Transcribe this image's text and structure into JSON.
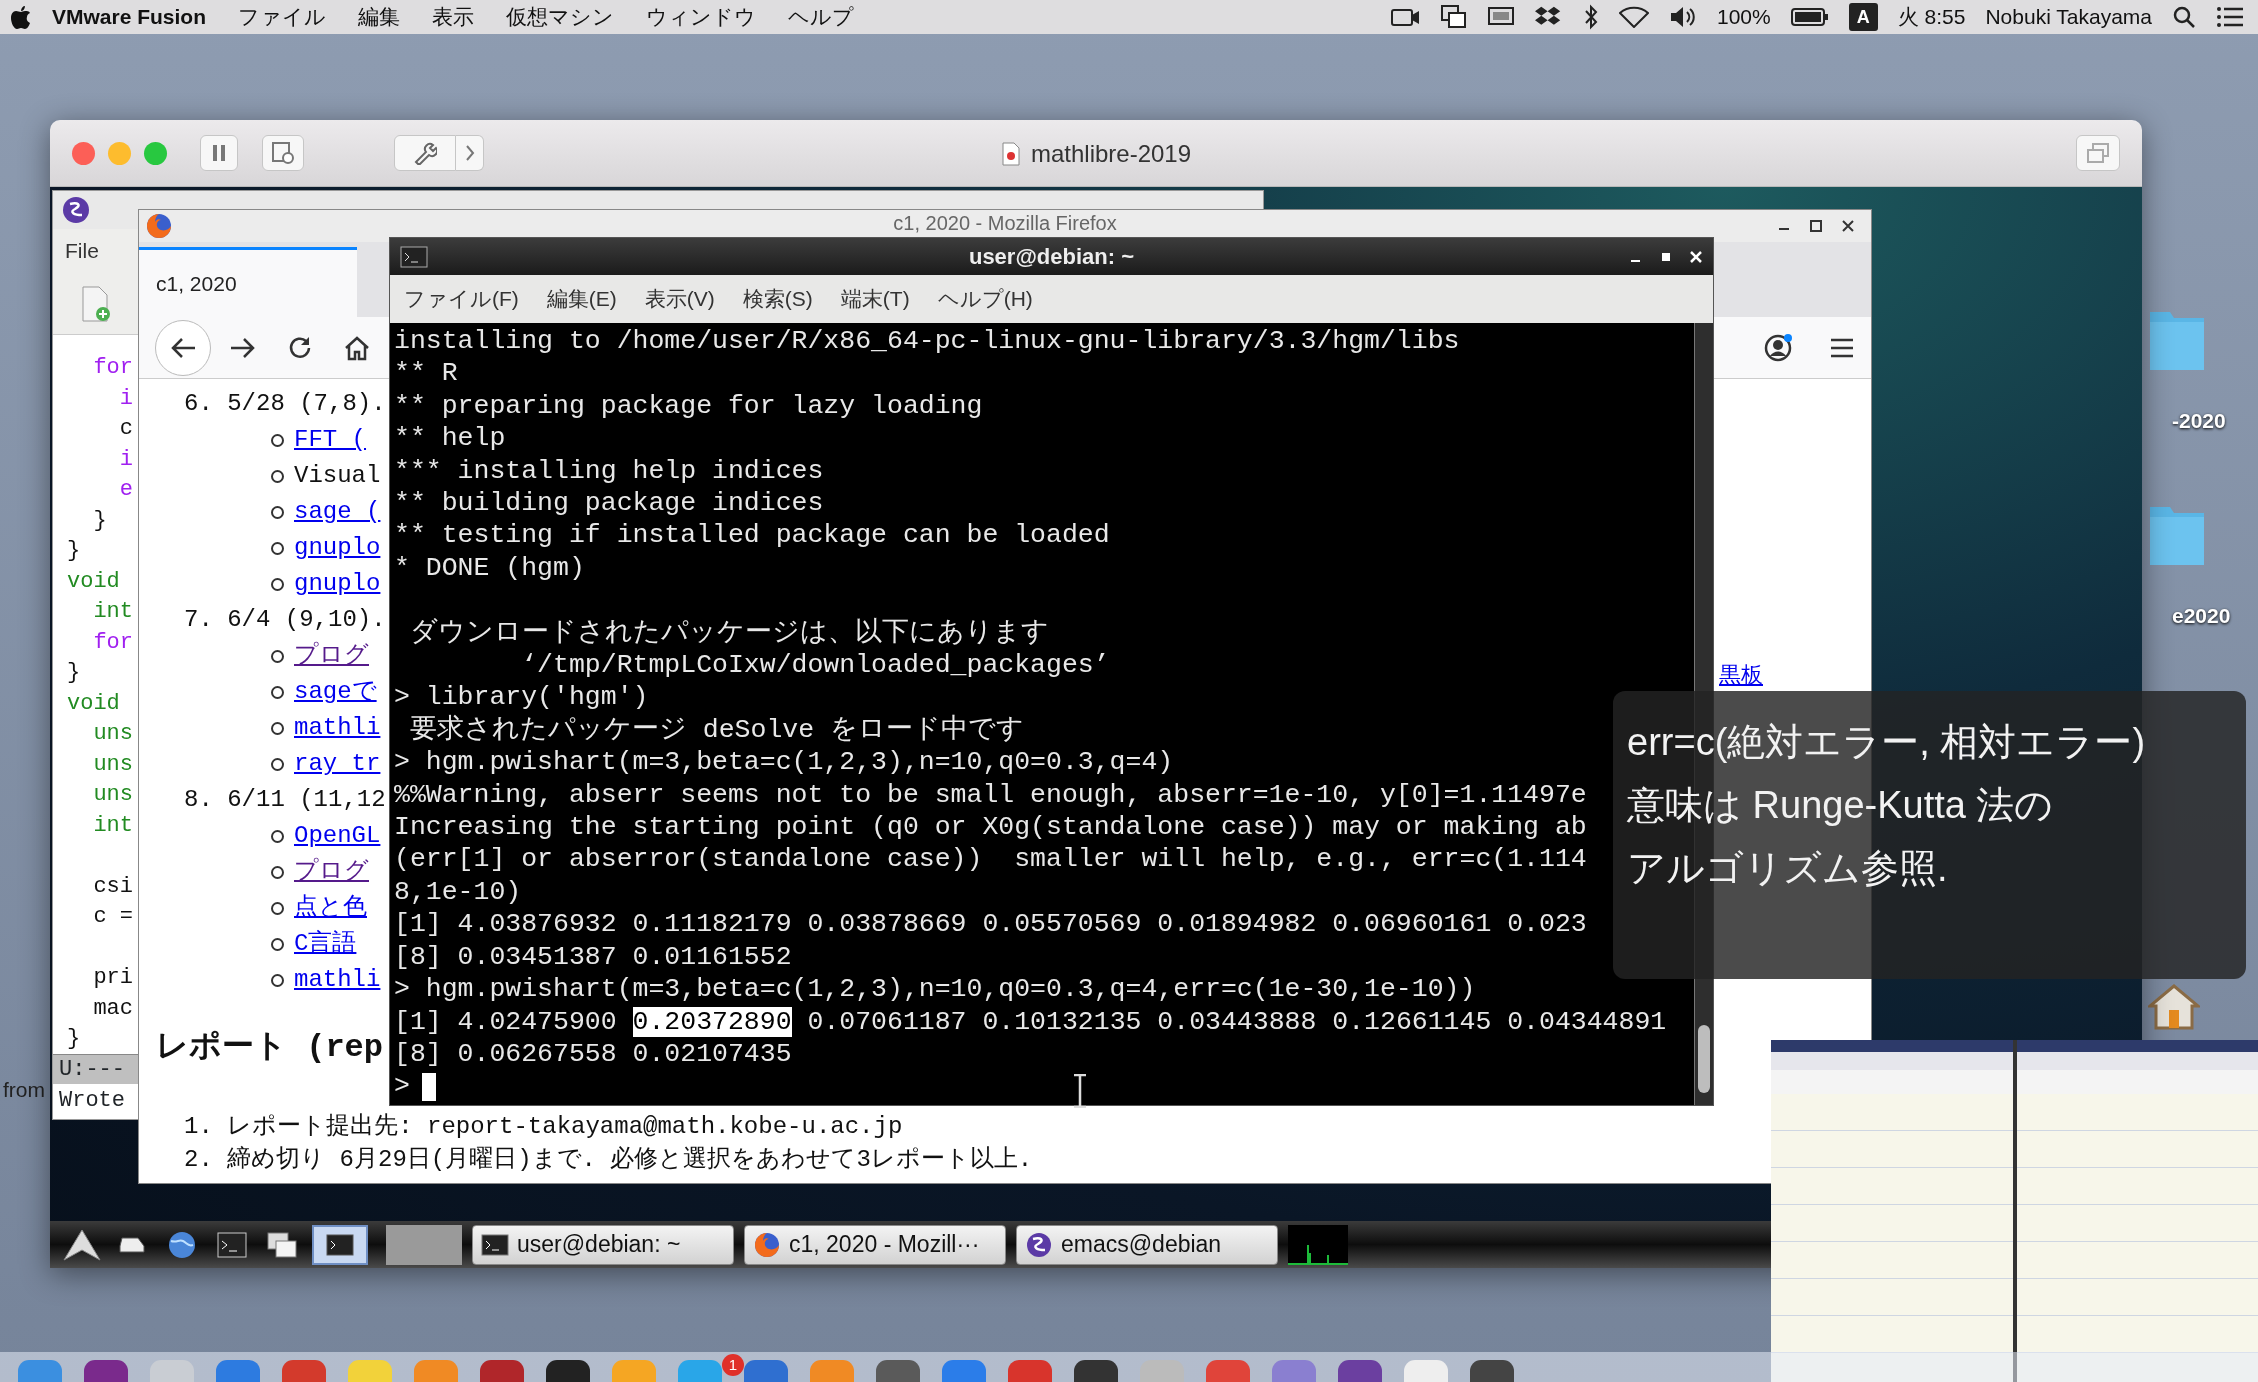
{
  "menu_bar": {
    "app": "VMware Fusion",
    "menus": [
      "ファイル",
      "編集",
      "表示",
      "仮想マシン",
      "ウィンドウ",
      "ヘルプ"
    ],
    "battery": "100%",
    "input_source": "A",
    "clock": "火 8:55",
    "user": "Nobuki Takayama"
  },
  "vm_window": {
    "title": "mathlibre-2019"
  },
  "emacs": {
    "menus": [
      "File"
    ],
    "lines": [
      {
        "text": "  for",
        "kind": "keyword"
      },
      {
        "text": "    i",
        "kind": "keyword"
      },
      {
        "text": "    c",
        "kind": "plain"
      },
      {
        "text": "    i",
        "kind": "keyword"
      },
      {
        "text": "    e",
        "kind": "keyword"
      },
      {
        "text": "  }",
        "kind": "plain"
      },
      {
        "text": "}",
        "kind": "plain"
      },
      {
        "text": "void",
        "kind": "type"
      },
      {
        "text": "  int",
        "kind": "type"
      },
      {
        "text": "  for",
        "kind": "keyword"
      },
      {
        "text": "}",
        "kind": "plain"
      },
      {
        "text": "void",
        "kind": "type"
      },
      {
        "text": "  uns",
        "kind": "type"
      },
      {
        "text": "  uns",
        "kind": "type"
      },
      {
        "text": "  uns",
        "kind": "type"
      },
      {
        "text": "  int",
        "kind": "type"
      },
      {
        "kind": "blank"
      },
      {
        "text": "  csi",
        "kind": "plain"
      },
      {
        "text": "  c =",
        "kind": "plain"
      },
      {
        "kind": "blank"
      },
      {
        "text": "  pri",
        "kind": "plain"
      },
      {
        "text": "  mac",
        "kind": "plain"
      },
      {
        "text": "}",
        "kind": "plain"
      }
    ],
    "mode_line": "U:---",
    "echo": "Wrote"
  },
  "firefox": {
    "title": "c1, 2020 - Mozilla Firefox",
    "tabs": [
      {
        "label": "c1, 2020",
        "selected": true
      }
    ],
    "schedule": [
      {
        "text": "6. 5/28 (7,8).",
        "children": [
          {
            "text": "FFT (",
            "kind": "link"
          },
          {
            "text": "Visual",
            "kind": "text"
          },
          {
            "text": "sage (",
            "kind": "link"
          },
          {
            "text": "gnuplo",
            "kind": "link"
          },
          {
            "text": "gnuplo",
            "kind": "link"
          }
        ]
      },
      {
        "text": "7. 6/4 (9,10).",
        "children": [
          {
            "text": "プログ",
            "kind": "visited"
          },
          {
            "text": "sageで",
            "kind": "link"
          },
          {
            "text": "mathli",
            "kind": "link"
          },
          {
            "text": "ray tr",
            "kind": "link"
          }
        ]
      },
      {
        "text": "8. 6/11 (11,12",
        "children": [
          {
            "text": "OpenGL",
            "kind": "link"
          },
          {
            "text": "プログ",
            "kind": "visited"
          },
          {
            "text": "点と色",
            "kind": "link"
          },
          {
            "text": "C言語",
            "kind": "link"
          },
          {
            "text": "mathli",
            "kind": "link"
          }
        ]
      }
    ],
    "heading": "レポート (rep",
    "report_items": [
      "1. レポート提出先: report-takayama@math.kobe-u.ac.jp",
      "2. 締め切り 6月29日(月曜日)まで. 必修と選択をあわせて3レポート以上."
    ],
    "side_link": "黒板"
  },
  "terminal": {
    "title": "user@debian: ~",
    "menus": [
      "ファイル(F)",
      "編集(E)",
      "表示(V)",
      "検索(S)",
      "端末(T)",
      "ヘルプ(H)"
    ],
    "lines": [
      {
        "text": "installing to /home/user/R/x86_64-pc-linux-gnu-library/3.3/hgm/libs"
      },
      {
        "text": "** R"
      },
      {
        "text": "** preparing package for lazy loading"
      },
      {
        "text": "** help"
      },
      {
        "text": "*** installing help indices"
      },
      {
        "text": "** building package indices"
      },
      {
        "text": "** testing if installed package can be loaded"
      },
      {
        "text": "* DONE (hgm)",
        "blank_after": true
      },
      {
        "text": " ダウンロードされたパッケージは、以下にあります"
      },
      {
        "text": "        ‘/tmp/RtmpLCoIxw/downloaded_packages’"
      },
      {
        "text": "> library('hgm')"
      },
      {
        "text": " 要求されたパッケージ deSolve をロード中です"
      },
      {
        "text": "> hgm.pwishart(m=3,beta=c(1,2,3),n=10,q0=0.3,q=4)"
      },
      {
        "text": "%%Warning, abserr seems not to be small enough, abserr=1e-10, y[0]=1.11497e"
      },
      {
        "text": "Increasing the starting point (q0 or X0g(standalone case)) may or making ab"
      },
      {
        "text": "(err[1] or abserror(standalone case))  smaller will help, e.g., err=c(1.114"
      },
      {
        "text": "8,1e-10)"
      },
      {
        "text": "[1] 4.03876932 0.11182179 0.03878669 0.05570569 0.01894982 0.06960161 0.023"
      },
      {
        "text": "[8] 0.03451387 0.01161552"
      },
      {
        "text": "> hgm.pwishart(m=3,beta=c(1,2,3),n=10,q0=0.3,q=4,err=c(1e-30,1e-10))"
      },
      {
        "text": "[1] 4.02475900 ",
        "highlight": "0.20372890",
        "rest": " 0.07061187 0.10132135 0.03443888 0.12661145 0.04344891"
      },
      {
        "text": "[8] 0.06267558 0.02107435"
      },
      {
        "text": ">",
        "cursor": true
      }
    ]
  },
  "taskbar": {
    "windows": [
      {
        "title": "user@debian: ~",
        "kind": "terminal"
      },
      {
        "title": "c1, 2020 - Mozill···",
        "kind": "firefox"
      },
      {
        "title": "emacs@debian",
        "kind": "emacs"
      }
    ]
  },
  "caption": [
    "err=c(絶対エラー, 相対エラー)",
    "意味は Runge-Kutta 法の",
    "アルゴリズム参照."
  ],
  "desktop_folders": [
    "-2020",
    "e2020"
  ],
  "side_text": "from",
  "dock": {
    "badge": "1"
  }
}
